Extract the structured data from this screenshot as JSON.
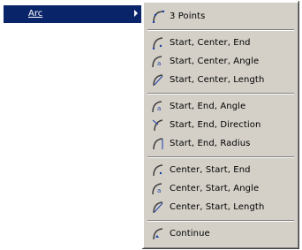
{
  "parent": {
    "label": "Arc"
  },
  "submenu": {
    "items": [
      {
        "label": "3 Points"
      },
      {
        "label": "Start, Center, End"
      },
      {
        "label": "Start, Center, Angle"
      },
      {
        "label": "Start, Center, Length"
      },
      {
        "label": "Start, End, Angle"
      },
      {
        "label": "Start, End, Direction"
      },
      {
        "label": "Start, End, Radius"
      },
      {
        "label": "Center, Start, End"
      },
      {
        "label": "Center, Start, Angle"
      },
      {
        "label": "Center, Start, Length"
      },
      {
        "label": "Continue"
      }
    ]
  },
  "colors": {
    "highlight": "#0a246a",
    "menu_bg": "#d4d0c8",
    "icon_arc": "#404040",
    "icon_accent": "#1a3fa8"
  }
}
